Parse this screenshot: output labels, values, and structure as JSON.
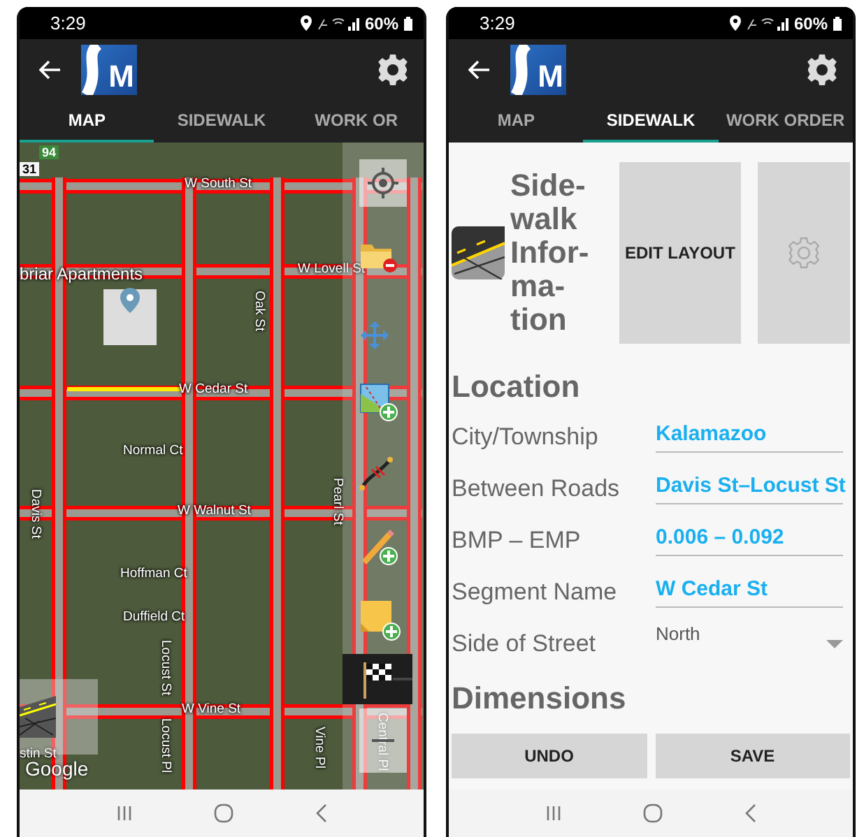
{
  "screens": [
    {
      "kind": "map",
      "status_bar": {
        "time": "3:29",
        "battery": "60%"
      },
      "logo_letter": "M",
      "tabs": [
        {
          "label": "MAP",
          "selected": true
        },
        {
          "label": "SIDEWALK",
          "selected": false
        },
        {
          "label": "WORK OR",
          "selected": false
        }
      ],
      "map": {
        "shields": [
          "94",
          "31"
        ],
        "labels": [
          {
            "text": "W South St",
            "vertical": false
          },
          {
            "text": "briar Apartments",
            "vertical": false
          },
          {
            "text": "W Lovell St",
            "vertical": false
          },
          {
            "text": "Oak St",
            "vertical": true
          },
          {
            "text": "W Cedar St",
            "vertical": false
          },
          {
            "text": "Normal Ct",
            "vertical": false
          },
          {
            "text": "Davis St",
            "vertical": true
          },
          {
            "text": "W Walnut St",
            "vertical": false
          },
          {
            "text": "Pearl St",
            "vertical": true
          },
          {
            "text": "Hoffman Ct",
            "vertical": false
          },
          {
            "text": "Duffield Ct",
            "vertical": false
          },
          {
            "text": "Locust St",
            "vertical": true
          },
          {
            "text": "W Vine St",
            "vertical": false
          },
          {
            "text": "Locust Pl",
            "vertical": true
          },
          {
            "text": "Vine Pl",
            "vertical": true
          },
          {
            "text": "Central Pl",
            "vertical": true
          },
          {
            "text": "stin St",
            "vertical": false
          }
        ],
        "attribution": "Google"
      }
    },
    {
      "kind": "form",
      "status_bar": {
        "time": "3:29",
        "battery": "60%"
      },
      "logo_letter": "M",
      "tabs": [
        {
          "label": "MAP",
          "selected": false
        },
        {
          "label": "SIDEWALK",
          "selected": true
        },
        {
          "label": "WORK ORDER",
          "selected": false
        }
      ],
      "title": "Side-walk Infor-ma-tion",
      "edit_button": "EDIT LAYOUT",
      "location_heading": "Location",
      "fields": [
        {
          "label": "City/Township",
          "value": "Kalamazoo",
          "kind": "text"
        },
        {
          "label": "Between Roads",
          "value": "Davis St–Locust St",
          "kind": "text"
        },
        {
          "label": "BMP – EMP",
          "value": "0.006 – 0.092",
          "kind": "text"
        },
        {
          "label": "Segment Name",
          "value": "W Cedar St",
          "kind": "text"
        },
        {
          "label": "Side of Street",
          "value": "North",
          "kind": "dropdown"
        }
      ],
      "dimensions_heading": "Dimensions",
      "buttons": [
        "UNDO",
        "SAVE"
      ]
    }
  ]
}
